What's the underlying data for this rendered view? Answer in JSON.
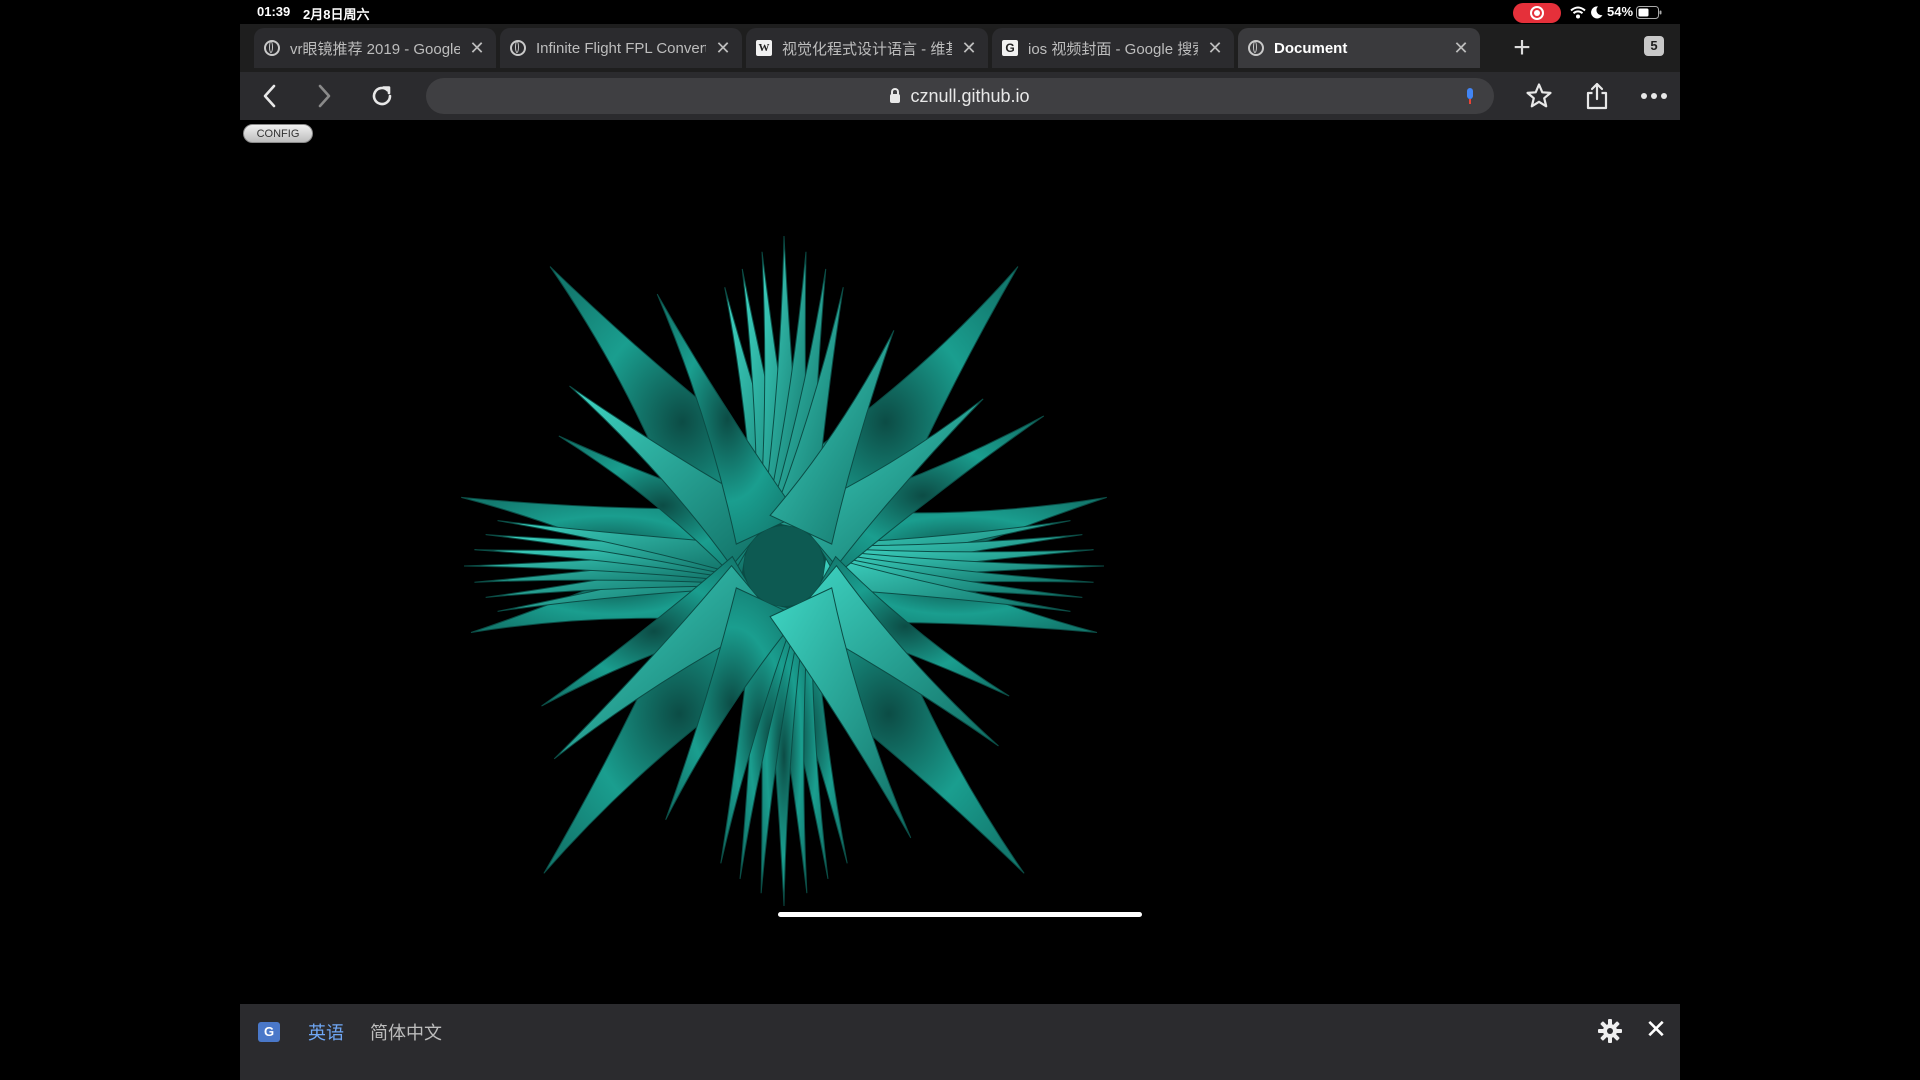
{
  "status_bar": {
    "time": "01:39",
    "date": "2月8日周六",
    "battery": "54%"
  },
  "browser": {
    "tabs": [
      {
        "title": "vr眼镜推荐 2019 - Google",
        "favicon": "globe-icon",
        "active": false
      },
      {
        "title": "Infinite Flight FPL Convert",
        "favicon": "globe-icon",
        "active": false
      },
      {
        "title": "视觉化程式设计语言 - 维基",
        "favicon": "wikipedia-icon",
        "active": false
      },
      {
        "title": "ios 视频封面 - Google 搜索",
        "favicon": "google-icon",
        "active": false
      },
      {
        "title": "Document",
        "favicon": "globe-icon",
        "active": true
      }
    ],
    "tab_count": "5",
    "url": "cznull.github.io"
  },
  "page": {
    "config_label": "CONFIG",
    "shape_color": "#1a9e8f"
  },
  "translate_bar": {
    "source_language": "英语",
    "target_language": "简体中文"
  },
  "colors": {
    "accent_blue": "#6fa7f5",
    "recording_red": "#e5303a",
    "shape_teal": "#1a9e8f"
  }
}
